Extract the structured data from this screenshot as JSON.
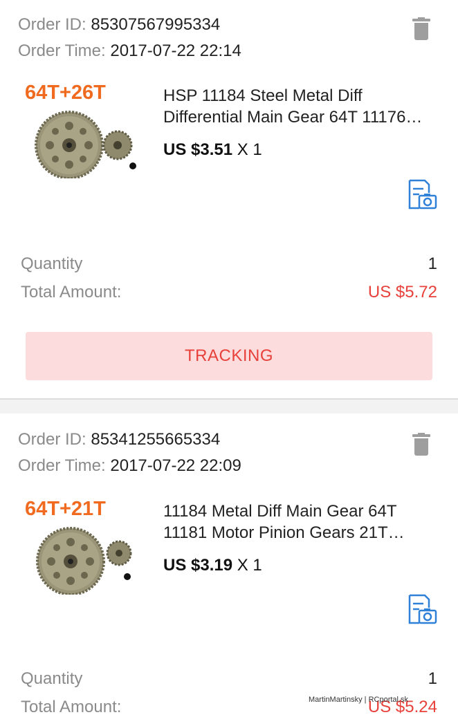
{
  "orders": [
    {
      "order_id_label": "Order ID:",
      "order_id": "85307567995334",
      "order_time_label": "Order Time:",
      "order_time": "2017-07-22 22:14",
      "thumb_tag": "64T+26T",
      "title_line1": "HSP 11184 Steel Metal Diff",
      "title_line2": "Differential Main Gear 64T 11176…",
      "price": "US $3.51",
      "qty_text": "X 1",
      "quantity_label": "Quantity",
      "quantity_value": "1",
      "total_label": "Total Amount:",
      "total_value": "US $5.72",
      "tracking_label": "TRACKING"
    },
    {
      "order_id_label": "Order ID:",
      "order_id": "85341255665334",
      "order_time_label": "Order Time:",
      "order_time": "2017-07-22 22:09",
      "thumb_tag": "64T+21T",
      "title_line1": "11184 Metal Diff Main Gear 64T",
      "title_line2": "11181 Motor Pinion Gears 21T…",
      "price": "US $3.19",
      "qty_text": "X 1",
      "quantity_label": "Quantity",
      "quantity_value": "1",
      "total_label": "Total Amount:",
      "total_value": "US $5.24"
    }
  ],
  "colors": {
    "accent_red": "#e8403a",
    "tracking_bg": "#fcdcdc",
    "tag_orange": "#f06a1f",
    "icon_blue": "#2f80d9"
  },
  "icons": {
    "delete": "trash-icon",
    "photo_review": "photo-review-icon"
  },
  "watermark": "MartinMartinsky | RCportal.sk"
}
